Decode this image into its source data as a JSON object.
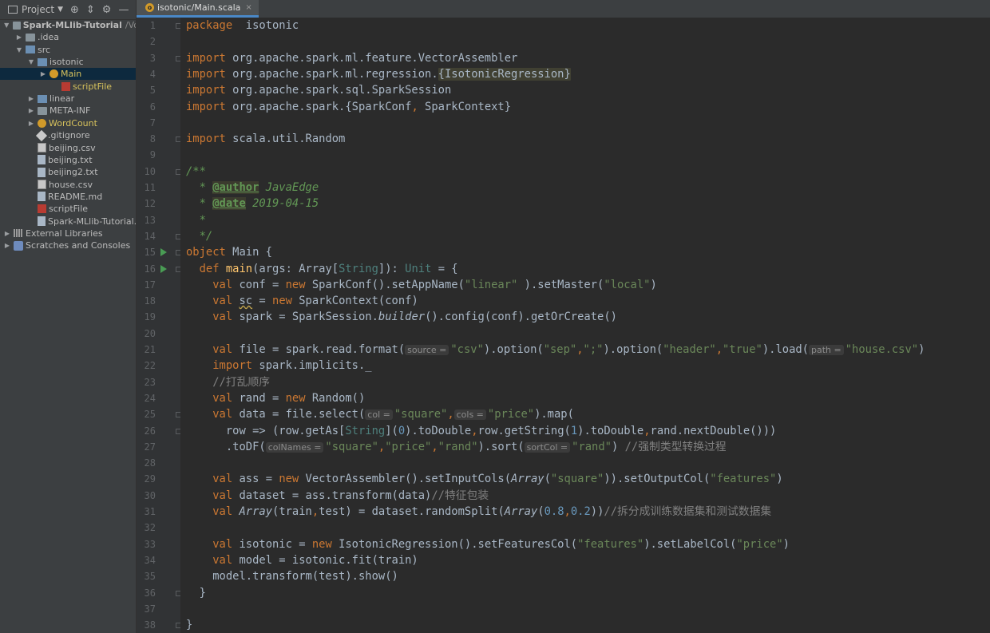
{
  "toolbar": {
    "project_label": "Project"
  },
  "tree": [
    {
      "label": "Spark-MLlib-Tutorial",
      "suffix": "/Vo",
      "arrow": "▼",
      "icon": "folder",
      "indent": 0,
      "bold": true
    },
    {
      "label": ".idea",
      "arrow": "▶",
      "icon": "folder",
      "indent": 1
    },
    {
      "label": "src",
      "arrow": "▼",
      "icon": "folder-src",
      "indent": 1
    },
    {
      "label": "isotonic",
      "arrow": "▼",
      "icon": "folder-src",
      "indent": 2
    },
    {
      "label": "Main",
      "arrow": "▶",
      "icon": "cls",
      "indent": 3,
      "selected": true,
      "color": "#d6c15c"
    },
    {
      "label": "scriptFile",
      "arrow": "",
      "icon": "scala",
      "indent": 4,
      "color": "#d6c15c"
    },
    {
      "label": "linear",
      "arrow": "▶",
      "icon": "folder-src",
      "indent": 2
    },
    {
      "label": "META-INF",
      "arrow": "▶",
      "icon": "folder",
      "indent": 2
    },
    {
      "label": "WordCount",
      "arrow": "▶",
      "icon": "cls",
      "indent": 2,
      "color": "#d6c15c"
    },
    {
      "label": ".gitignore",
      "arrow": "",
      "icon": "git",
      "indent": 2
    },
    {
      "label": "beijing.csv",
      "arrow": "",
      "icon": "csv",
      "indent": 2
    },
    {
      "label": "beijing.txt",
      "arrow": "",
      "icon": "file",
      "indent": 2
    },
    {
      "label": "beijing2.txt",
      "arrow": "",
      "icon": "file",
      "indent": 2
    },
    {
      "label": "house.csv",
      "arrow": "",
      "icon": "csv",
      "indent": 2
    },
    {
      "label": "README.md",
      "arrow": "",
      "icon": "file",
      "indent": 2
    },
    {
      "label": "scriptFile",
      "arrow": "",
      "icon": "scala",
      "indent": 2
    },
    {
      "label": "Spark-MLlib-Tutorial.iml",
      "arrow": "",
      "icon": "file",
      "indent": 2
    },
    {
      "label": "External Libraries",
      "arrow": "▶",
      "icon": "lib",
      "indent": 0
    },
    {
      "label": "Scratches and Consoles",
      "arrow": "▶",
      "icon": "scratch",
      "indent": 0
    }
  ],
  "tab": {
    "label": "isotonic/Main.scala",
    "close": "×"
  },
  "code": [
    [
      [
        "k",
        "package"
      ],
      [
        "",
        "  isotonic"
      ]
    ],
    [],
    [
      [
        "k",
        "import"
      ],
      [
        "",
        " org.apache.spark.ml.feature.VectorAssembler"
      ]
    ],
    [
      [
        "k",
        "import"
      ],
      [
        "",
        " org.apache.spark.ml.regression."
      ],
      [
        "hl",
        "{IsotonicRegression}"
      ]
    ],
    [
      [
        "k",
        "import"
      ],
      [
        "",
        " org.apache.spark.sql.SparkSession"
      ]
    ],
    [
      [
        "k",
        "import"
      ],
      [
        "",
        " org.apache.spark.{SparkConf"
      ],
      [
        "k",
        ","
      ],
      [
        "",
        " SparkContext}"
      ]
    ],
    [],
    [
      [
        "k",
        "import"
      ],
      [
        "",
        " scala.util.Random"
      ]
    ],
    [],
    [
      [
        "d",
        "/**"
      ]
    ],
    [
      [
        "d",
        "  * "
      ],
      [
        "tag",
        "@author"
      ],
      [
        "d",
        " JavaEdge"
      ]
    ],
    [
      [
        "d",
        "  * "
      ],
      [
        "tag",
        "@date"
      ],
      [
        "d",
        " 2019-04-15"
      ]
    ],
    [
      [
        "d",
        "  *"
      ]
    ],
    [
      [
        "d",
        "  */"
      ]
    ],
    [
      [
        "k",
        "object"
      ],
      [
        "",
        " Main {"
      ]
    ],
    [
      [
        "",
        "  "
      ],
      [
        "k",
        "def"
      ],
      [
        "",
        " "
      ],
      [
        "fn",
        "main"
      ],
      [
        "",
        "(args: Array["
      ],
      [
        "tp",
        "String"
      ],
      [
        "",
        "]): "
      ],
      [
        "tp",
        "Unit"
      ],
      [
        "",
        " = {"
      ]
    ],
    [
      [
        "",
        "    "
      ],
      [
        "k",
        "val"
      ],
      [
        "",
        " conf = "
      ],
      [
        "k",
        "new"
      ],
      [
        "",
        " SparkConf().setAppName("
      ],
      [
        "s",
        "\"linear\""
      ],
      [
        "",
        " ).setMaster("
      ],
      [
        "s",
        "\"local\""
      ],
      [
        "",
        ")"
      ]
    ],
    [
      [
        "",
        "    "
      ],
      [
        "k",
        "val"
      ],
      [
        "",
        " "
      ],
      [
        "warn",
        "sc"
      ],
      [
        "",
        " = "
      ],
      [
        "k",
        "new"
      ],
      [
        "",
        " SparkContext(conf)"
      ]
    ],
    [
      [
        "",
        "    "
      ],
      [
        "k",
        "val"
      ],
      [
        "",
        " spark = SparkSession."
      ],
      [
        "it",
        "builder"
      ],
      [
        "",
        "().config(conf).getOrCreate()"
      ]
    ],
    [],
    [
      [
        "",
        "    "
      ],
      [
        "k",
        "val"
      ],
      [
        "",
        " file = spark.read.format("
      ],
      [
        "hint",
        "source ="
      ],
      [
        "s",
        "\"csv\""
      ],
      [
        "",
        ").option("
      ],
      [
        "s",
        "\"sep\""
      ],
      [
        "k",
        ","
      ],
      [
        "s",
        "\";\""
      ],
      [
        "",
        ").option("
      ],
      [
        "s",
        "\"header\""
      ],
      [
        "k",
        ","
      ],
      [
        "s",
        "\"true\""
      ],
      [
        "",
        ").load("
      ],
      [
        "hint",
        "path ="
      ],
      [
        "s",
        "\"house.csv\""
      ],
      [
        "",
        ")"
      ]
    ],
    [
      [
        "",
        "    "
      ],
      [
        "k",
        "import"
      ],
      [
        "",
        " spark.implicits._"
      ]
    ],
    [
      [
        "",
        "    "
      ],
      [
        "c",
        "//打乱顺序"
      ]
    ],
    [
      [
        "",
        "    "
      ],
      [
        "k",
        "val"
      ],
      [
        "",
        " rand = "
      ],
      [
        "k",
        "new"
      ],
      [
        "",
        " Random()"
      ]
    ],
    [
      [
        "",
        "    "
      ],
      [
        "k",
        "val"
      ],
      [
        "",
        " data = file.select("
      ],
      [
        "hint",
        "col ="
      ],
      [
        "s",
        "\"square\""
      ],
      [
        "k",
        ","
      ],
      [
        "hint",
        "cols ="
      ],
      [
        "s",
        "\"price\""
      ],
      [
        "",
        ").map("
      ]
    ],
    [
      [
        "",
        "      row => (row.getAs["
      ],
      [
        "tp",
        "String"
      ],
      [
        "",
        "]("
      ],
      [
        "n",
        "0"
      ],
      [
        "",
        ").toDouble"
      ],
      [
        "k",
        ","
      ],
      [
        "",
        "row.getString("
      ],
      [
        "n",
        "1"
      ],
      [
        "",
        ").toDouble"
      ],
      [
        "k",
        ","
      ],
      [
        "",
        "rand.nextDouble()))"
      ]
    ],
    [
      [
        "",
        "      .toDF("
      ],
      [
        "hint",
        "colNames ="
      ],
      [
        "s",
        "\"square\""
      ],
      [
        "k",
        ","
      ],
      [
        "s",
        "\"price\""
      ],
      [
        "k",
        ","
      ],
      [
        "s",
        "\"rand\""
      ],
      [
        "",
        ").sort("
      ],
      [
        "hint",
        "sortCol ="
      ],
      [
        "s",
        "\"rand\""
      ],
      [
        "",
        ") "
      ],
      [
        "c",
        "//强制类型转换过程"
      ]
    ],
    [],
    [
      [
        "",
        "    "
      ],
      [
        "k",
        "val"
      ],
      [
        "",
        " ass = "
      ],
      [
        "k",
        "new"
      ],
      [
        "",
        " VectorAssembler().setInputCols("
      ],
      [
        "it",
        "Array"
      ],
      [
        "",
        "("
      ],
      [
        "s",
        "\"square\""
      ],
      [
        "",
        ")).setOutputCol("
      ],
      [
        "s",
        "\"features\""
      ],
      [
        "",
        ")"
      ]
    ],
    [
      [
        "",
        "    "
      ],
      [
        "k",
        "val"
      ],
      [
        "",
        " dataset = ass.transform(data)"
      ],
      [
        "c",
        "//特征包装"
      ]
    ],
    [
      [
        "",
        "    "
      ],
      [
        "k",
        "val"
      ],
      [
        "",
        " "
      ],
      [
        "it",
        "Array"
      ],
      [
        "",
        "(train"
      ],
      [
        "k",
        ","
      ],
      [
        "",
        "test) = dataset.randomSplit("
      ],
      [
        "it",
        "Array"
      ],
      [
        "",
        "("
      ],
      [
        "n",
        "0.8"
      ],
      [
        "k",
        ","
      ],
      [
        "n",
        "0.2"
      ],
      [
        "",
        "))"
      ],
      [
        "c",
        "//拆分成训练数据集和测试数据集"
      ]
    ],
    [],
    [
      [
        "",
        "    "
      ],
      [
        "k",
        "val"
      ],
      [
        "",
        " isotonic = "
      ],
      [
        "k",
        "new"
      ],
      [
        "",
        " IsotonicRegression().setFeaturesCol("
      ],
      [
        "s",
        "\"features\""
      ],
      [
        "",
        ").setLabelCol("
      ],
      [
        "s",
        "\"price\""
      ],
      [
        "",
        ")"
      ]
    ],
    [
      [
        "",
        "    "
      ],
      [
        "k",
        "val"
      ],
      [
        "",
        " model = isotonic.fit(train)"
      ]
    ],
    [
      [
        "",
        "    model.transform(test).show()"
      ]
    ],
    [
      [
        "",
        "  }"
      ]
    ],
    [],
    [
      [
        "",
        "}"
      ]
    ]
  ],
  "run_lines": [
    15,
    16
  ],
  "fold_lines": [
    1,
    3,
    8,
    10,
    14,
    15,
    16,
    25,
    26,
    36,
    38
  ]
}
